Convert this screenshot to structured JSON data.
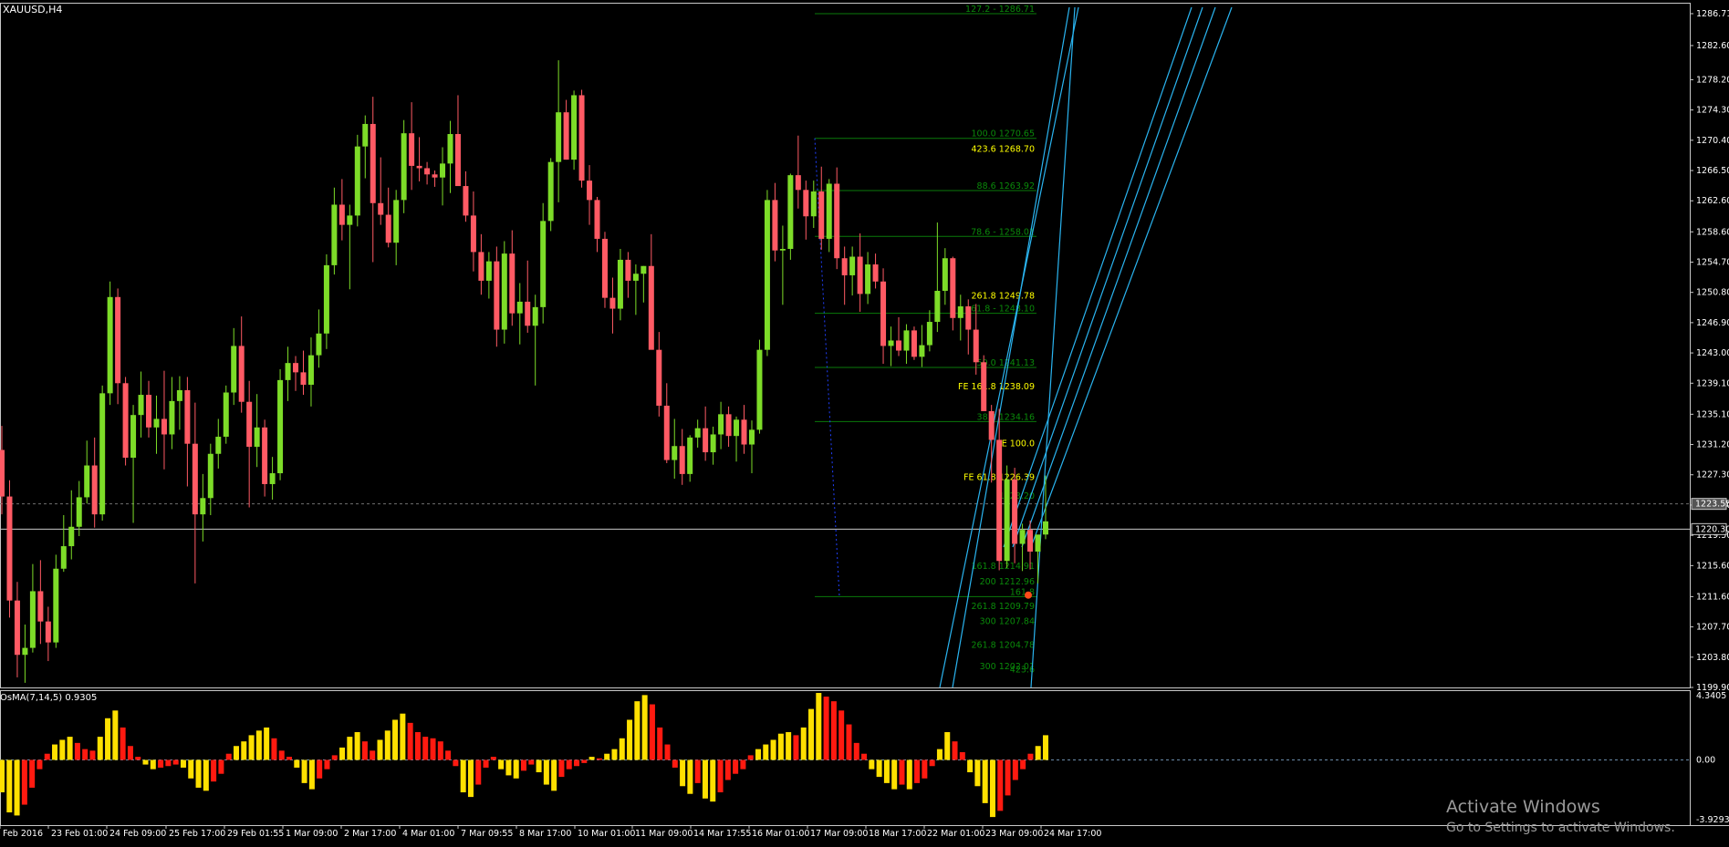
{
  "window": {
    "title": "XAUUSD,H4"
  },
  "indicator": {
    "label": "OsMA(7,14,5) 0.9305",
    "max_label": "4.3405",
    "zero_label": "0.00",
    "min_label": "-3.9293"
  },
  "watermark": {
    "line1": "Activate Windows",
    "line2": "Go to Settings to activate Windows."
  },
  "chart_data": {
    "type": "candlestick",
    "symbol": "XAUUSD",
    "timeframe": "H4",
    "y_ticks": [
      1286.71,
      1282.6,
      1278.2,
      1274.3,
      1270.4,
      1266.5,
      1262.6,
      1258.6,
      1254.7,
      1250.8,
      1246.9,
      1243.0,
      1239.1,
      1235.1,
      1231.2,
      1227.3,
      1223.4,
      1219.5,
      1215.6,
      1211.6,
      1207.7,
      1203.8,
      1199.9
    ],
    "ylim": [
      1199.9,
      1288.0
    ],
    "current_price": "1223.55",
    "hline_price": "1220.30",
    "x_labels": [
      "Feb 2016",
      "23 Feb 01:00",
      "24 Feb 09:00",
      "25 Feb 17:00",
      "29 Feb 01:55",
      "1 Mar 09:00",
      "2 Mar 17:00",
      "4 Mar 01:00",
      "7 Mar 09:55",
      "8 Mar 17:00",
      "10 Mar 01:00",
      "11 Mar 09:00",
      "14 Mar 17:55",
      "16 Mar 01:00",
      "17 Mar 09:00",
      "18 Mar 17:00",
      "22 Mar 01:00",
      "23 Mar 09:00",
      "24 Mar 17:00"
    ],
    "candles": [
      [
        1230.5,
        1233.6,
        1222.2,
        1224.5
      ],
      [
        1224.5,
        1226.6,
        1208.9,
        1211.1
      ],
      [
        1211.1,
        1213.5,
        1201.2,
        1204.1
      ],
      [
        1204.1,
        1208.0,
        1200.5,
        1205.0
      ],
      [
        1205.0,
        1215.8,
        1204.4,
        1212.3
      ],
      [
        1212.3,
        1216.3,
        1205.5,
        1208.4
      ],
      [
        1208.4,
        1210.3,
        1203.3,
        1205.7
      ],
      [
        1205.7,
        1217.0,
        1205.0,
        1215.2
      ],
      [
        1215.2,
        1222.1,
        1214.8,
        1218.1
      ],
      [
        1218.1,
        1225.3,
        1216.4,
        1220.6
      ],
      [
        1220.6,
        1226.5,
        1219.4,
        1224.4
      ],
      [
        1224.4,
        1231.7,
        1223.6,
        1228.5
      ],
      [
        1228.5,
        1232.1,
        1220.5,
        1222.2
      ],
      [
        1222.2,
        1238.8,
        1221.4,
        1237.8
      ],
      [
        1237.8,
        1252.2,
        1236.3,
        1250.2
      ],
      [
        1250.2,
        1251.3,
        1236.4,
        1239.1
      ],
      [
        1239.1,
        1239.9,
        1228.5,
        1229.5
      ],
      [
        1229.5,
        1236.3,
        1221.1,
        1235.0
      ],
      [
        1235.0,
        1240.6,
        1232.1,
        1237.6
      ],
      [
        1237.6,
        1239.4,
        1232.1,
        1233.4
      ],
      [
        1233.4,
        1237.5,
        1230.0,
        1234.5
      ],
      [
        1234.5,
        1240.7,
        1228.0,
        1232.5
      ],
      [
        1232.5,
        1239.9,
        1230.6,
        1236.8
      ],
      [
        1236.8,
        1240.0,
        1233.1,
        1238.2
      ],
      [
        1238.2,
        1239.9,
        1225.8,
        1231.3
      ],
      [
        1231.3,
        1236.6,
        1213.3,
        1222.2
      ],
      [
        1222.2,
        1227.4,
        1218.7,
        1224.3
      ],
      [
        1224.3,
        1231.3,
        1222.1,
        1230.0
      ],
      [
        1230.0,
        1234.5,
        1228.1,
        1232.2
      ],
      [
        1232.2,
        1238.8,
        1231.3,
        1237.9
      ],
      [
        1237.9,
        1246.2,
        1236.3,
        1243.9
      ],
      [
        1243.9,
        1247.7,
        1235.3,
        1236.7
      ],
      [
        1236.7,
        1239.4,
        1223.1,
        1230.9
      ],
      [
        1230.9,
        1237.7,
        1228.3,
        1233.4
      ],
      [
        1233.4,
        1234.4,
        1224.5,
        1226.1
      ],
      [
        1226.1,
        1229.6,
        1224.1,
        1227.5
      ],
      [
        1227.5,
        1240.9,
        1226.6,
        1239.5
      ],
      [
        1239.5,
        1243.8,
        1236.8,
        1241.7
      ],
      [
        1241.7,
        1242.6,
        1238.1,
        1240.5
      ],
      [
        1240.5,
        1243.3,
        1237.6,
        1238.9
      ],
      [
        1238.9,
        1245.0,
        1236.1,
        1242.7
      ],
      [
        1242.7,
        1248.6,
        1241.1,
        1245.5
      ],
      [
        1245.5,
        1255.7,
        1243.5,
        1254.3
      ],
      [
        1254.3,
        1264.3,
        1253.1,
        1262.1
      ],
      [
        1262.1,
        1265.4,
        1257.5,
        1259.5
      ],
      [
        1259.5,
        1262.1,
        1251.2,
        1260.7
      ],
      [
        1260.7,
        1271.1,
        1259.3,
        1269.6
      ],
      [
        1269.6,
        1273.6,
        1265.5,
        1272.5
      ],
      [
        1272.5,
        1276.0,
        1254.7,
        1262.3
      ],
      [
        1262.3,
        1268.2,
        1259.5,
        1260.8
      ],
      [
        1260.8,
        1264.3,
        1256.6,
        1257.2
      ],
      [
        1257.2,
        1264.0,
        1254.3,
        1262.7
      ],
      [
        1262.7,
        1273.0,
        1261.0,
        1271.3
      ],
      [
        1271.3,
        1275.3,
        1264.0,
        1267.1
      ],
      [
        1267.1,
        1270.8,
        1265.1,
        1266.8
      ],
      [
        1266.8,
        1267.6,
        1264.7,
        1266.0
      ],
      [
        1266.0,
        1266.5,
        1264.4,
        1265.6
      ],
      [
        1265.6,
        1269.5,
        1262.0,
        1267.4
      ],
      [
        1267.4,
        1272.9,
        1263.6,
        1271.2
      ],
      [
        1271.2,
        1276.2,
        1267.1,
        1264.5
      ],
      [
        1264.5,
        1266.4,
        1259.9,
        1260.7
      ],
      [
        1260.7,
        1263.8,
        1253.5,
        1256.0
      ],
      [
        1256.0,
        1258.3,
        1250.5,
        1252.3
      ],
      [
        1252.3,
        1256.0,
        1250.0,
        1254.8
      ],
      [
        1254.8,
        1256.7,
        1243.8,
        1246.0
      ],
      [
        1246.0,
        1257.4,
        1244.2,
        1255.8
      ],
      [
        1255.8,
        1258.8,
        1246.5,
        1248.1
      ],
      [
        1248.1,
        1252.0,
        1244.1,
        1249.6
      ],
      [
        1249.6,
        1254.9,
        1245.6,
        1246.5
      ],
      [
        1246.5,
        1250.5,
        1238.8,
        1248.9
      ],
      [
        1248.9,
        1262.3,
        1246.8,
        1260.0
      ],
      [
        1260.0,
        1268.1,
        1258.7,
        1267.6
      ],
      [
        1267.6,
        1280.7,
        1262.4,
        1274.0
      ],
      [
        1274.0,
        1275.6,
        1267.9,
        1267.9
      ],
      [
        1267.9,
        1276.8,
        1266.6,
        1276.2
      ],
      [
        1276.2,
        1276.9,
        1264.3,
        1265.2
      ],
      [
        1265.2,
        1267.2,
        1259.5,
        1262.7
      ],
      [
        1262.7,
        1263.1,
        1256.0,
        1257.7
      ],
      [
        1257.7,
        1258.6,
        1248.8,
        1250.1
      ],
      [
        1250.1,
        1252.7,
        1245.5,
        1248.7
      ],
      [
        1248.7,
        1256.4,
        1247.2,
        1255.0
      ],
      [
        1255.0,
        1256.0,
        1250.1,
        1252.3
      ],
      [
        1252.3,
        1254.4,
        1247.9,
        1253.2
      ],
      [
        1253.2,
        1254.2,
        1249.5,
        1254.2
      ],
      [
        1254.2,
        1258.3,
        1250.9,
        1243.4
      ],
      [
        1243.4,
        1245.7,
        1234.8,
        1236.2
      ],
      [
        1236.2,
        1239.1,
        1228.8,
        1229.2
      ],
      [
        1229.2,
        1234.5,
        1226.8,
        1231.0
      ],
      [
        1231.0,
        1233.2,
        1226.0,
        1227.4
      ],
      [
        1227.4,
        1232.4,
        1226.4,
        1232.1
      ],
      [
        1232.1,
        1234.4,
        1230.8,
        1233.3
      ],
      [
        1233.3,
        1236.1,
        1229.1,
        1230.2
      ],
      [
        1230.2,
        1233.5,
        1228.6,
        1232.5
      ],
      [
        1232.5,
        1236.7,
        1230.6,
        1235.1
      ],
      [
        1235.1,
        1236.1,
        1230.9,
        1232.3
      ],
      [
        1232.3,
        1234.8,
        1229.0,
        1234.4
      ],
      [
        1234.4,
        1236.3,
        1230.0,
        1231.2
      ],
      [
        1231.2,
        1234.3,
        1227.5,
        1233.1
      ],
      [
        1233.1,
        1244.7,
        1232.6,
        1243.4
      ],
      [
        1243.4,
        1264.0,
        1242.6,
        1262.7
      ],
      [
        1262.7,
        1264.9,
        1254.8,
        1256.2
      ],
      [
        1256.2,
        1259.4,
        1249.2,
        1256.4
      ],
      [
        1256.4,
        1266.1,
        1255.0,
        1265.9
      ],
      [
        1265.9,
        1271.0,
        1261.6,
        1264.0
      ],
      [
        1264.0,
        1265.2,
        1257.6,
        1260.6
      ],
      [
        1260.6,
        1265.2,
        1259.1,
        1263.8
      ],
      [
        1263.8,
        1267.0,
        1256.3,
        1257.7
      ],
      [
        1257.7,
        1265.4,
        1256.0,
        1264.8
      ],
      [
        1264.8,
        1266.9,
        1253.8,
        1255.2
      ],
      [
        1255.2,
        1256.7,
        1249.2,
        1253.0
      ],
      [
        1253.0,
        1256.7,
        1250.4,
        1255.4
      ],
      [
        1255.4,
        1258.4,
        1248.3,
        1250.6
      ],
      [
        1250.6,
        1256.0,
        1249.3,
        1254.4
      ],
      [
        1254.4,
        1255.8,
        1251.3,
        1252.2
      ],
      [
        1252.2,
        1253.9,
        1241.6,
        1243.9
      ],
      [
        1243.9,
        1246.4,
        1241.3,
        1244.6
      ],
      [
        1244.6,
        1247.6,
        1242.6,
        1243.3
      ],
      [
        1243.3,
        1246.7,
        1241.6,
        1245.9
      ],
      [
        1245.9,
        1246.4,
        1242.1,
        1242.5
      ],
      [
        1242.5,
        1246.6,
        1241.2,
        1244.0
      ],
      [
        1244.0,
        1248.5,
        1243.2,
        1247.0
      ],
      [
        1247.0,
        1259.8,
        1245.7,
        1251.0
      ],
      [
        1251.0,
        1256.5,
        1249.2,
        1255.2
      ],
      [
        1255.2,
        1255.4,
        1245.9,
        1247.5
      ],
      [
        1247.5,
        1250.5,
        1244.6,
        1249.0
      ],
      [
        1249.0,
        1249.9,
        1242.8,
        1246.0
      ],
      [
        1246.0,
        1249.3,
        1240.2,
        1241.8
      ],
      [
        1241.8,
        1242.7,
        1235.6,
        1235.5
      ],
      [
        1235.5,
        1236.3,
        1226.3,
        1231.8
      ],
      [
        1231.8,
        1235.8,
        1215.0,
        1216.2
      ],
      [
        1216.2,
        1228.5,
        1215.3,
        1226.7
      ],
      [
        1226.7,
        1228.2,
        1215.9,
        1218.4
      ],
      [
        1218.4,
        1221.0,
        1214.9,
        1220.2
      ],
      [
        1220.2,
        1221.4,
        1215.1,
        1217.4
      ],
      [
        1217.4,
        1218.8,
        1213.3,
        1219.6
      ],
      [
        1219.6,
        1227.2,
        1219.0,
        1221.3
      ]
    ],
    "fib_levels": [
      {
        "label": "127.2 - 1286.71",
        "price": 1286.71,
        "color": "#0a8a0a"
      },
      {
        "label": "100.0 1270.65",
        "price": 1270.65,
        "color": "#0a8a0a"
      },
      {
        "label": "423.6 1268.70",
        "price": 1268.7,
        "color": "#ffff00"
      },
      {
        "label": "88.6 1263.92",
        "price": 1263.92,
        "color": "#0a8a0a"
      },
      {
        "label": "78.6 - 1258.01",
        "price": 1258.01,
        "color": "#0a8a0a"
      },
      {
        "label": "261.8 1249.78",
        "price": 1249.78,
        "color": "#ffff00"
      },
      {
        "label": "61.8 - 1248.10",
        "price": 1248.1,
        "color": "#0a8a0a"
      },
      {
        "label": "50.0 1241.13",
        "price": 1241.13,
        "color": "#0a8a0a"
      },
      {
        "label": "FE 161.8 1238.09",
        "price": 1238.09,
        "color": "#ffff00"
      },
      {
        "label": "38.2 1234.16",
        "price": 1234.16,
        "color": "#0a8a0a"
      },
      {
        "label": "FE 100.0",
        "price": 1230.75,
        "color": "#ffff00"
      },
      {
        "label": "FE 61.8 1226.39",
        "price": 1226.39,
        "color": "#ffff00"
      },
      {
        "label": "1223.20",
        "price": 1224.0,
        "color": "#0a8a0a"
      },
      {
        "label": "161.8 1214.91",
        "price": 1214.91,
        "color": "#0a8a0a"
      },
      {
        "label": "200 1212.96",
        "price": 1212.96,
        "color": "#0a8a0a"
      },
      {
        "label": "161.8",
        "price": 1211.6,
        "color": "#0a8a0a"
      },
      {
        "label": "261.8 1209.79",
        "price": 1209.79,
        "color": "#0a8a0a"
      },
      {
        "label": "300 1207.84",
        "price": 1207.84,
        "color": "#0a8a0a"
      },
      {
        "label": "261.8 1204.78",
        "price": 1204.78,
        "color": "#0a8a0a"
      },
      {
        "label": "300 1202.01",
        "price": 1202.01,
        "color": "#0a8a0a"
      },
      {
        "label": "423.6",
        "price": 1201.6,
        "color": "#0a8a0a"
      }
    ],
    "osma": {
      "ylim": [
        -3.9293,
        4.3405
      ],
      "values": [
        -2.1,
        -3.4,
        -3.6,
        -2.9,
        -1.8,
        -0.6,
        0.4,
        1.0,
        1.3,
        1.5,
        1.1,
        0.7,
        0.6,
        1.5,
        2.7,
        3.2,
        2.1,
        0.9,
        0.2,
        -0.3,
        -0.6,
        -0.5,
        -0.4,
        -0.3,
        -0.5,
        -1.2,
        -1.8,
        -2.0,
        -1.4,
        -0.9,
        0.4,
        0.9,
        1.2,
        1.6,
        1.9,
        2.1,
        1.4,
        0.6,
        0.2,
        -0.5,
        -1.5,
        -1.9,
        -1.2,
        -0.6,
        0.3,
        0.8,
        1.5,
        1.8,
        1.2,
        0.6,
        1.3,
        1.9,
        2.6,
        3.0,
        2.4,
        1.8,
        1.5,
        1.4,
        1.2,
        0.6,
        -0.4,
        -2.1,
        -2.4,
        -1.6,
        -0.5,
        0.2,
        -0.6,
        -1.0,
        -1.2,
        -0.7,
        -0.3,
        -0.8,
        -1.6,
        -2.0,
        -1.1,
        -0.6,
        -0.4,
        -0.2,
        0.2,
        0.1,
        0.4,
        0.7,
        1.4,
        2.6,
        3.8,
        4.2,
        3.6,
        2.1,
        1.0,
        -0.5,
        -1.7,
        -2.2,
        -1.5,
        -2.5,
        -2.7,
        -2.1,
        -1.3,
        -0.9,
        -0.6,
        0.3,
        0.7,
        1.0,
        1.3,
        1.7,
        1.8,
        1.6,
        2.1,
        3.3,
        4.34,
        4.1,
        3.8,
        3.2,
        2.3,
        1.1,
        0.4,
        -0.6,
        -1.1,
        -1.5,
        -1.9,
        -1.6,
        -1.9,
        -1.5,
        -1.2,
        -0.4,
        0.7,
        1.8,
        1.2,
        0.5,
        -0.8,
        -1.7,
        -2.8,
        -3.7,
        -3.3,
        -2.3,
        -1.3,
        -0.6,
        0.4,
        0.9,
        1.6
      ]
    }
  }
}
